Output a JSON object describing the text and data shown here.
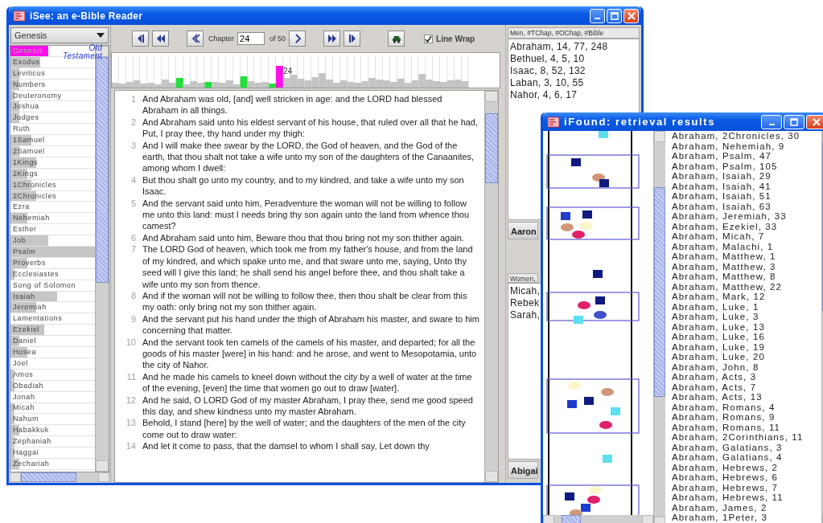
{
  "main_window": {
    "title": "iSee: an e-Bible Reader",
    "book_selector": {
      "value": "Genesis"
    },
    "section_label": "Old Testament",
    "books": [
      {
        "name": "Genesis",
        "selected": true,
        "level": 0.45
      },
      {
        "name": "Exodus",
        "selected": false,
        "level": 0.35
      },
      {
        "name": "Leviticus",
        "selected": false,
        "level": 0.1
      },
      {
        "name": "Numbers",
        "selected": false,
        "level": 0.1
      },
      {
        "name": "Deuteronomy",
        "selected": false,
        "level": 0.05
      },
      {
        "name": "Joshua",
        "selected": false,
        "level": 0.1
      },
      {
        "name": "Judges",
        "selected": false,
        "level": 0.1
      },
      {
        "name": "Ruth",
        "selected": false
      },
      {
        "name": "1Samuel",
        "selected": false,
        "level": 0.25
      },
      {
        "name": "2Samuel",
        "selected": false,
        "level": 0.1
      },
      {
        "name": "1Kings",
        "selected": false,
        "level": 0.3
      },
      {
        "name": "2Kings",
        "selected": false,
        "level": 0.2
      },
      {
        "name": "1Chronicles",
        "selected": false,
        "level": 0.25
      },
      {
        "name": "2Chronicles",
        "selected": false,
        "level": 0.3
      },
      {
        "name": "Ezra",
        "selected": false
      },
      {
        "name": "Nehemiah",
        "selected": false,
        "level": 0.2
      },
      {
        "name": "Esther",
        "selected": false
      },
      {
        "name": "Job",
        "selected": false,
        "level": 0.45
      },
      {
        "name": "Psalm",
        "selected": false,
        "level": 1.0
      },
      {
        "name": "Proverbs",
        "selected": false,
        "level": 0.2
      },
      {
        "name": "Ecclesiastes",
        "selected": false,
        "level": 0.05
      },
      {
        "name": "Song of Solomon",
        "selected": false
      },
      {
        "name": "Isaiah",
        "selected": false,
        "level": 0.55
      },
      {
        "name": "Jeremiah",
        "selected": false,
        "level": 0.3
      },
      {
        "name": "Lamentations",
        "selected": false
      },
      {
        "name": "Ezekiel",
        "selected": false,
        "level": 0.4
      },
      {
        "name": "Daniel",
        "selected": false,
        "level": 0.1
      },
      {
        "name": "Hosea",
        "selected": false,
        "level": 0.2
      },
      {
        "name": "Joel",
        "selected": false
      },
      {
        "name": "Amos",
        "selected": false,
        "level": 0.05
      },
      {
        "name": "Obadiah",
        "selected": false,
        "level": 0.05
      },
      {
        "name": "Jonah",
        "selected": false
      },
      {
        "name": "Micah",
        "selected": false,
        "level": 0.05
      },
      {
        "name": "Nahum",
        "selected": false,
        "level": 0.05
      },
      {
        "name": "Habakkuk",
        "selected": false,
        "level": 0.1
      },
      {
        "name": "Zephaniah",
        "selected": false,
        "level": 0.05
      },
      {
        "name": "Haggai",
        "selected": false,
        "level": 0.05
      },
      {
        "name": "Zechariah",
        "selected": false,
        "level": 0.1
      }
    ],
    "toolbar": {
      "chapter_label": "Chapter",
      "chapter": "24",
      "of_label": "of 50",
      "line_wrap": {
        "label": "Line Wrap",
        "checked": true
      }
    },
    "chapter_histogram": {
      "marker_label": "24"
    },
    "verses": [
      {
        "number": "1",
        "text": "And Abraham was old, [and] well stricken in age: and the LORD had blessed Abraham in all things."
      },
      {
        "number": "2",
        "text": "And Abraham said unto his eldest servant of his house, that ruled over all that he had, Put, I pray thee, thy hand under my thigh:"
      },
      {
        "number": "3",
        "text": "And I will make thee swear by the LORD, the God of heaven, and the God of the earth, that thou shalt not take a wife unto my son of the daughters of the Canaanites, among whom I dwell:"
      },
      {
        "number": "4",
        "text": "But thou shalt go unto my country, and to my kindred, and take a wife unto my son Isaac."
      },
      {
        "number": "5",
        "text": "And the servant said unto him, Peradventure the woman will not be willing to follow me unto this land: must I needs bring thy son again unto the land from whence thou camest?"
      },
      {
        "number": "6",
        "text": "And Abraham said unto him, Beware thou that thou bring not my son thither again."
      },
      {
        "number": "7",
        "text": "The LORD God of heaven, which took me from my father's house, and from the land of my kindred, and which spake unto me, and that sware unto me, saying, Unto thy seed will I give this land; he shall send his angel before thee, and thou shalt take a wife unto my son from thence."
      },
      {
        "number": "8",
        "text": "And if the woman will not be willing to follow thee, then thou shalt be clear from this my oath: only bring not my son thither again."
      },
      {
        "number": "9",
        "text": "And the servant put his hand under the thigh of Abraham his master, and sware to him concerning that matter."
      },
      {
        "number": "10",
        "text": "And the servant took ten camels of the camels of his master, and departed; for all the goods of his master [were] in his hand: and he arose, and went to Mesopotamia, unto the city of Nahor."
      },
      {
        "number": "11",
        "text": "And he made his camels to kneel down without the city by a well of water at the time of the evening, [even] the time that women go out to draw [water]."
      },
      {
        "number": "12",
        "text": "And he said, O LORD God of my master Abraham, I pray thee, send me good speed this day, and shew kindness unto my master Abraham."
      },
      {
        "number": "13",
        "text": "Behold, I stand [here] by the well of water; and the daughters of the men of the city come out to draw water:"
      },
      {
        "number": "14",
        "text": "And let it come to pass, that the damsel to whom I shall say, Let down thy"
      }
    ],
    "right_panel": {
      "men_header": "Men, #TChap, #OChap, #Bible",
      "men": [
        "Abraham, 14, 77, 248",
        "Bethuel, 4, 5, 10",
        "Isaac, 8, 52, 132",
        "Laban, 3, 10, 55",
        "Nahor, 4, 6, 17"
      ],
      "group_1": "Aaron",
      "women_header": "Women,",
      "women": [
        "Micah,",
        "Rebek",
        "Sarah,"
      ],
      "group_2": "Abigai"
    }
  },
  "results_window": {
    "title": "iFound: retrieval results",
    "results": [
      "Abraham, 2Chronicles, 30",
      "Abraham, Nehemiah, 9",
      "Abraham, Psalm, 47",
      "Abraham, Psalm, 105",
      "Abraham, Isaiah, 29",
      "Abraham, Isaiah, 41",
      "Abraham, Isaiah, 51",
      "Abraham, Isaiah, 63",
      "Abraham, Jeremiah, 33",
      "Abraham, Ezekiel, 33",
      "Abraham, Micah, 7",
      "Abraham, Malachi, 1",
      "Abraham, Matthew, 1",
      "Abraham, Matthew, 3",
      "Abraham, Matthew, 8",
      "Abraham, Matthew, 22",
      "Abraham, Mark, 12",
      "Abraham, Luke, 1",
      "Abraham, Luke, 3",
      "Abraham, Luke, 13",
      "Abraham, Luke, 16",
      "Abraham, Luke, 19",
      "Abraham, Luke, 20",
      "Abraham, John, 8",
      "Abraham, Acts, 3",
      "Abraham, Acts, 7",
      "Abraham, Acts, 13",
      "Abraham, Romans, 4",
      "Abraham, Romans, 9",
      "Abraham, Romans, 11",
      "Abraham, 2Corinthians, 11",
      "Abraham, Galatians, 3",
      "Abraham, Galatians, 4",
      "Abraham, Hebrews, 2",
      "Abraham, Hebrews, 6",
      "Abraham, Hebrews, 7",
      "Abraham, Hebrews, 11",
      "Abraham, James, 2",
      "Abraham, 1Peter, 3"
    ]
  }
}
